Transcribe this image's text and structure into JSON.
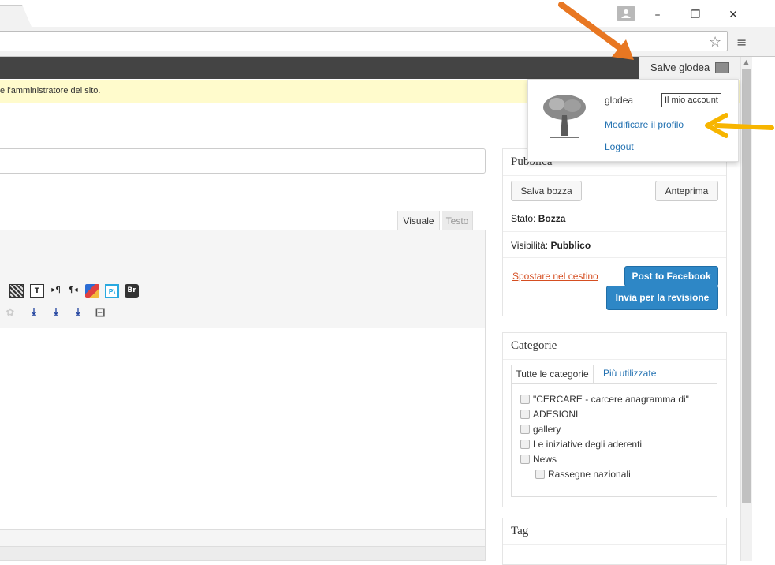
{
  "adminbar": {
    "greeting": "Salve glodea"
  },
  "notice": {
    "text": "e l'amministratore del sito."
  },
  "editor": {
    "tabs": {
      "visual": "Visuale",
      "text": "Testo"
    },
    "toolbar": {
      "t": "T",
      "ltr": "▸¶",
      "rtl": "¶◂",
      "pl": "P\\",
      "br": "Br"
    }
  },
  "publish": {
    "title": "Pubblica",
    "save_draft": "Salva bozza",
    "preview": "Anteprima",
    "status_label": "Stato:",
    "status_value": "Bozza",
    "visibility_label": "Visibilità:",
    "visibility_value": "Pubblico",
    "trash": "Spostare nel cestino",
    "facebook": "Post to Facebook",
    "submit_review": "Invia per la revisione"
  },
  "categories": {
    "title": "Categorie",
    "tab_all": "Tutte le categorie",
    "tab_popular": "Più utilizzate",
    "items": [
      "\"CERCARE - carcere anagramma di\"",
      "ADESIONI",
      "gallery",
      "Le iniziative degli aderenti",
      "News",
      "Rassegne nazionali"
    ]
  },
  "tags": {
    "title": "Tag"
  },
  "account_menu": {
    "username": "glodea",
    "tooltip": "Il mio account",
    "edit_profile": "Modificare il profilo",
    "logout": "Logout"
  },
  "colors": {
    "adminbar": "#444444",
    "link": "#2271b1",
    "primary_button": "#2e87c6",
    "trash": "#d54e21",
    "notice_bg": "#fffbcc",
    "annotation_orange": "#e87722",
    "annotation_yellow": "#f7b500"
  }
}
